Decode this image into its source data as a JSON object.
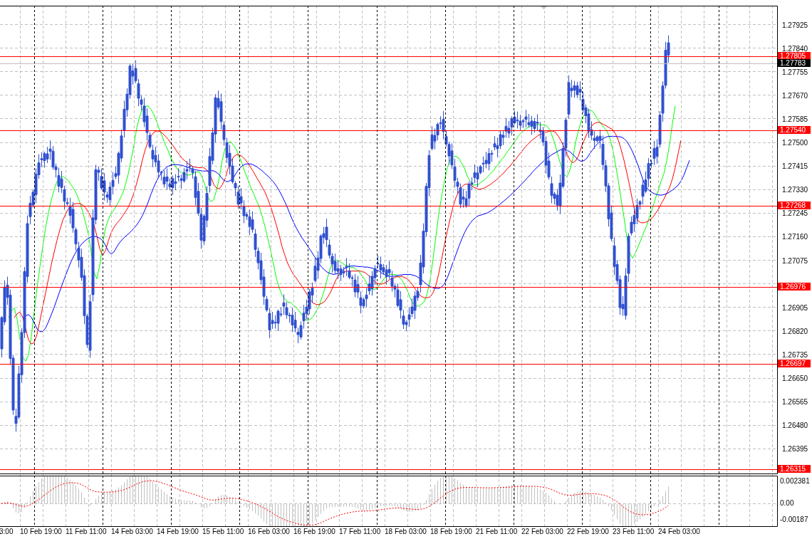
{
  "price_axis": {
    "ticks": [
      "1.27925",
      "1.27840",
      "1.27755",
      "1.27670",
      "1.27585",
      "1.27500",
      "1.27415",
      "1.27330",
      "1.27245",
      "1.27160",
      "1.27075",
      "1.26905",
      "1.26820",
      "1.26735",
      "1.26650",
      "1.26565",
      "1.26480",
      "1.26395"
    ]
  },
  "levels": [
    {
      "price": "1.27805"
    },
    {
      "price": "1.27540"
    },
    {
      "price": "1.27268"
    },
    {
      "price": "1.26976"
    },
    {
      "price": "1.26697"
    },
    {
      "price": "1.26315"
    }
  ],
  "current_price": "1.27783",
  "indicator_axis": {
    "ticks": [
      "0.002381",
      "0.00",
      "-0.00187"
    ]
  },
  "time_axis": {
    "labels": [
      "3:00",
      "10 Feb 19:00",
      "11 Feb 11:00",
      "14 Feb 03:00",
      "14 Feb 19:00",
      "15 Feb 11:00",
      "16 Feb 03:00",
      "16 Feb 19:00",
      "17 Feb 11:00",
      "18 Feb 03:00",
      "18 Feb 19:00",
      "21 Feb 11:00",
      "22 Feb 03:00",
      "22 Feb 19:00",
      "23 Feb 11:00",
      "24 Feb 03:00"
    ]
  }
}
